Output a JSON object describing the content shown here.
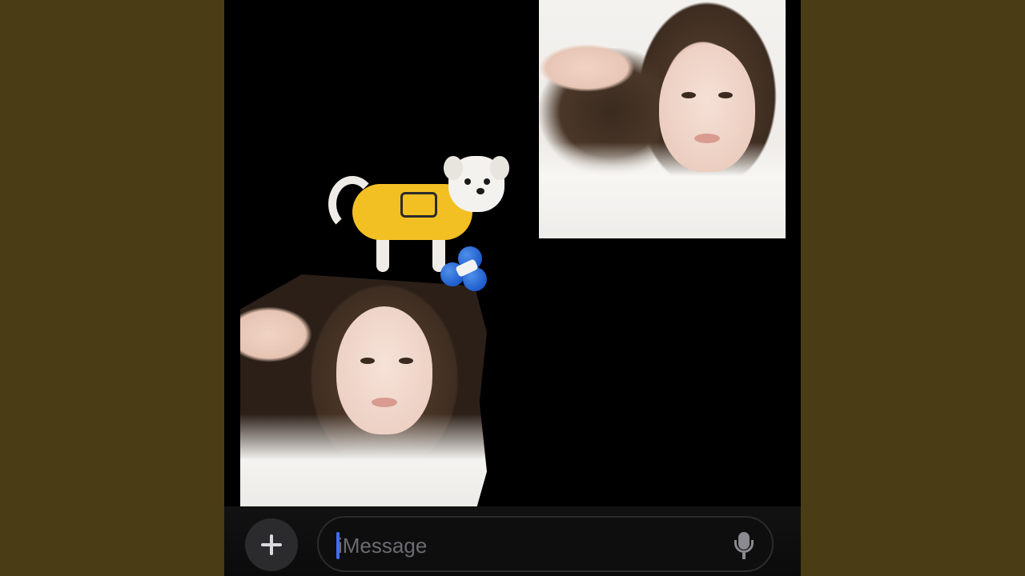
{
  "composer": {
    "placeholder": "iMessage",
    "value": ""
  },
  "icons": {
    "add": "plus-icon",
    "microphone": "microphone-icon"
  },
  "colors": {
    "background": "#4a3c14",
    "screen": "#000000",
    "caret": "#3f6df6",
    "button": "#2b2b2d"
  }
}
